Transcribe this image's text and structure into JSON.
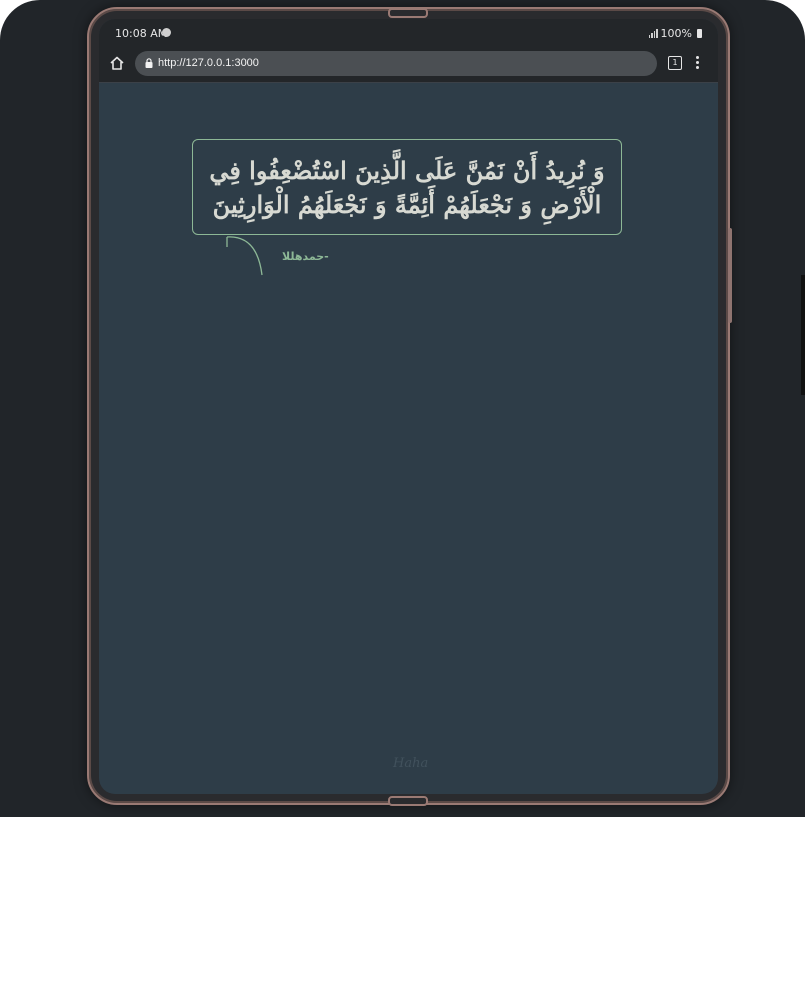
{
  "status_bar": {
    "time": "10:08 AM",
    "battery": "100%",
    "icons": [
      "spotify-icon",
      "signal-icon",
      "battery-icon"
    ]
  },
  "browser": {
    "url": "http://127.0.0.1:3000",
    "tab_count": "1",
    "icons": [
      "home-icon",
      "lock-icon",
      "tabs-icon",
      "menu-icon"
    ]
  },
  "quote": {
    "text": "وَ نُرِيدُ أَنْ نَمُنَّ عَلَى الَّذِينَ اسْتُضْعِفُوا فِي الْأَرْضِ وَ نَجْعَلَهُمْ أَئِمَّةً وَ نَجْعَلَهُمُ الْوَارِثِينَ",
    "attribution": "-حمدهللا"
  },
  "footer": {
    "logo_text": "Haha"
  },
  "colors": {
    "frame_background": "#212529",
    "screen_background": "#2e3d48",
    "accent_green": "#8db896",
    "quote_text": "#d7d9d2"
  }
}
